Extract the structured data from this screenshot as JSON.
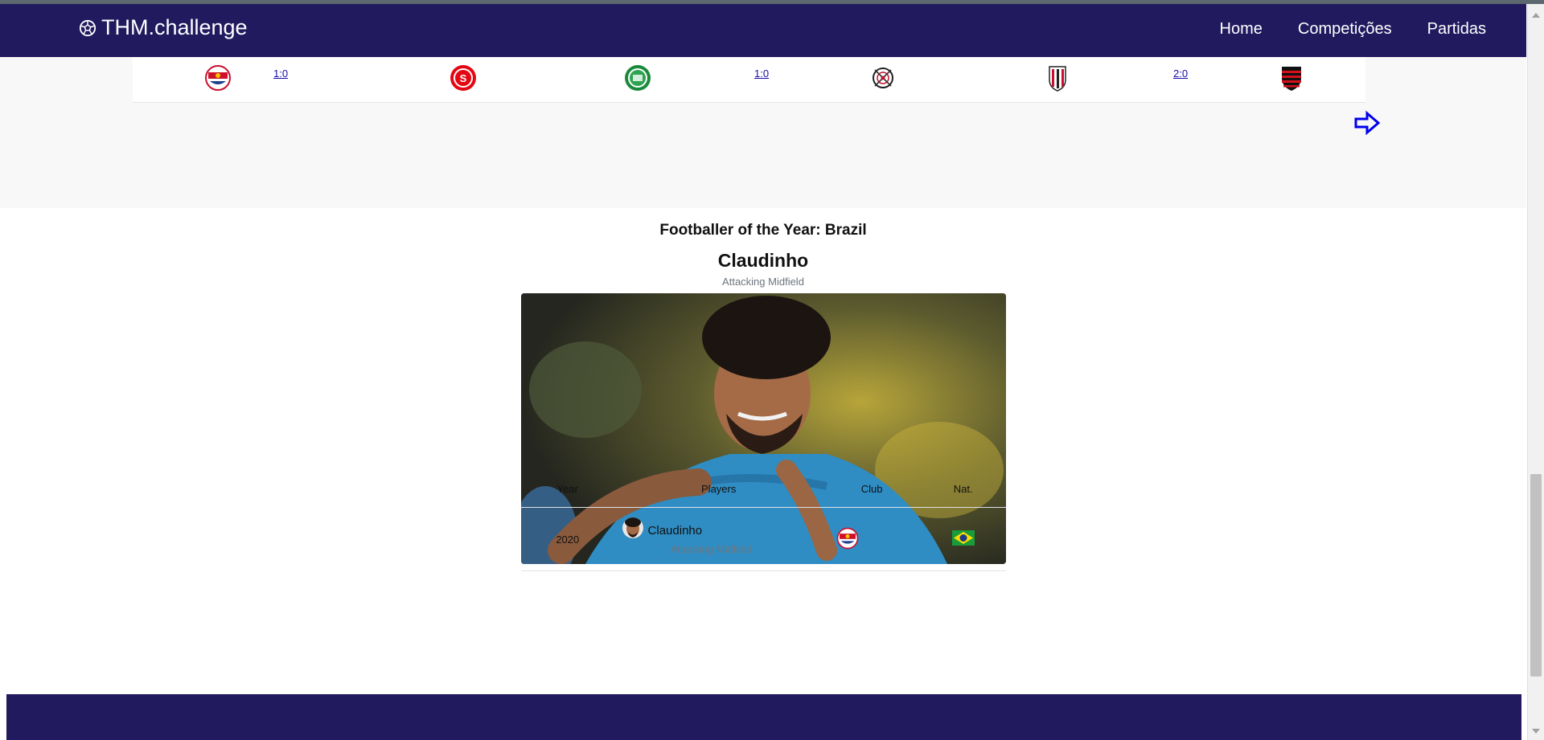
{
  "navbar": {
    "brand": "THM.challenge",
    "brand_icon": "soccer-ball-icon",
    "links": [
      "Home",
      "Competições",
      "Partidas"
    ],
    "bg_color": "#211a5f"
  },
  "matches": [
    {
      "home_icon": "red-bull-bragantino-crest-icon",
      "score": "1:0",
      "away_icon": "internacional-crest-icon"
    },
    {
      "home_icon": "juventude-crest-icon",
      "score": "1:0",
      "away_icon": "corinthians-crest-icon"
    },
    {
      "home_icon": "atletico-goianiense-crest-icon",
      "score": "2:0",
      "away_icon": "flamengo-crest-icon"
    }
  ],
  "next_icon": "arrow-right-icon",
  "foty": {
    "title": "Footballer of the Year: Brazil",
    "player_name": "Claudinho",
    "position": "Attacking Midfield"
  },
  "table": {
    "headers": [
      "Year",
      "Players",
      "Club",
      "Nat."
    ],
    "rows": [
      {
        "year": "2020",
        "player": "Claudinho",
        "position": "Attacking Midfield",
        "club_icon": "red-bull-bragantino-crest-icon",
        "nat_icon": "brazil-flag-icon"
      }
    ]
  }
}
